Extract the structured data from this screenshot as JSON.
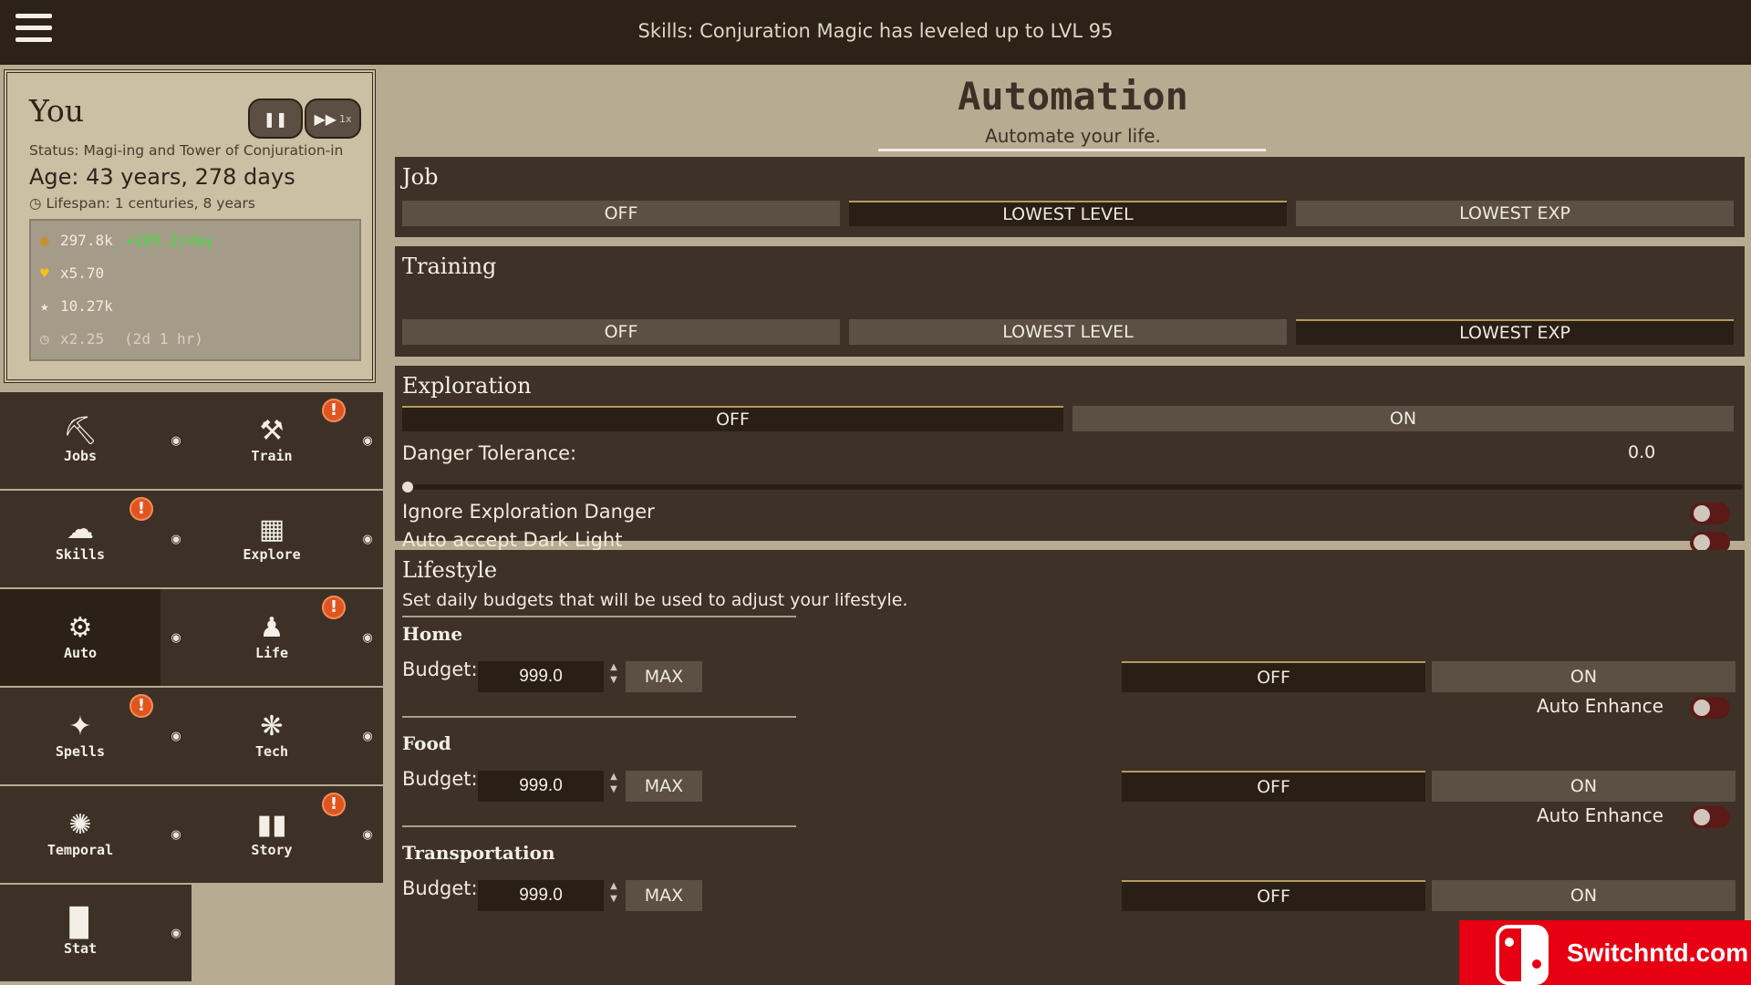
{
  "topbar": {
    "notification": "Skills: Conjuration Magic has leveled up to LVL 95"
  },
  "player": {
    "name": "You",
    "speed_label": "1x",
    "status": "Status: Magi-ing and Tower of Conjuration-in",
    "age": "Age: 43 years, 278 days",
    "lifespan": "Lifespan: 1 centuries, 8 years",
    "coins": "297.8k",
    "coins_rate": "+285.2/day",
    "hearts": "x5.70",
    "stars": "10.27k",
    "time_mult": "x2.25",
    "time_extra": "(2d 1 hr)"
  },
  "nav": [
    {
      "label": "Jobs",
      "icon": "pickaxe-icon"
    },
    {
      "label": "Train",
      "icon": "hammer-icon"
    },
    {
      "label": "Skills",
      "icon": "brain-icon"
    },
    {
      "label": "Explore",
      "icon": "map-icon"
    },
    {
      "label": "Auto",
      "icon": "gear-icon"
    },
    {
      "label": "Life",
      "icon": "people-icon"
    },
    {
      "label": "Spells",
      "icon": "spell-icon"
    },
    {
      "label": "Tech",
      "icon": "gears-icon"
    },
    {
      "label": "Temporal",
      "icon": "temporal-icon"
    },
    {
      "label": "Story",
      "icon": "book-icon"
    },
    {
      "label": "Stat",
      "icon": "bar-chart-icon"
    }
  ],
  "alert_mark": "!",
  "main": {
    "title": "Automation",
    "subtitle": "Automate your life.",
    "job": {
      "title": "Job",
      "options": [
        "OFF",
        "LOWEST LEVEL",
        "LOWEST EXP"
      ],
      "selected": "LOWEST LEVEL"
    },
    "training": {
      "title": "Training",
      "options": [
        "OFF",
        "LOWEST LEVEL",
        "LOWEST EXP"
      ],
      "selected": "LOWEST EXP"
    },
    "exploration": {
      "title": "Exploration",
      "options": [
        "OFF",
        "ON"
      ],
      "selected": "OFF",
      "danger_label": "Danger Tolerance:",
      "danger_value": "0.0",
      "ignore_danger_label": "Ignore Exploration Danger",
      "dark_light_label": "Auto accept Dark Light"
    },
    "lifestyle": {
      "title": "Lifestyle",
      "description": "Set daily budgets that will be used to adjust your lifestyle.",
      "budget_label": "Budget:",
      "max_label": "MAX",
      "off_label": "OFF",
      "on_label": "ON",
      "enhance_label": "Auto Enhance",
      "home": {
        "title": "Home",
        "budget": "999.0"
      },
      "food": {
        "title": "Food",
        "budget": "999.0"
      },
      "transport": {
        "title": "Transportation",
        "budget": "999.0"
      }
    }
  },
  "watermark": {
    "text": "Switchntd.com"
  },
  "colors": {
    "accent": "#b49c5c",
    "panel": "#3e3127",
    "button": "#5c5044",
    "selected": "#2a1f15",
    "alert": "#e0551f"
  }
}
